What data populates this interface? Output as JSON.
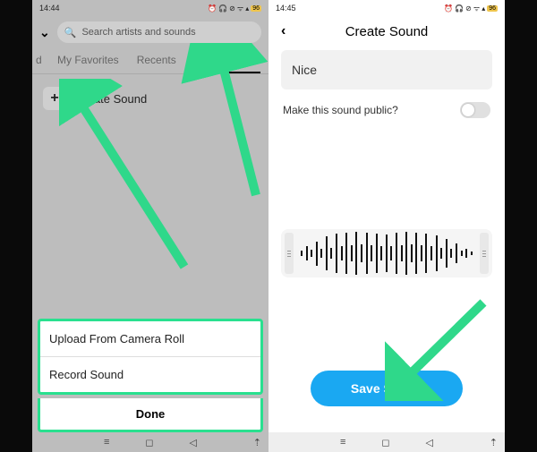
{
  "left": {
    "status": {
      "time": "14:44",
      "battery": "96"
    },
    "search_placeholder": "Search artists and sounds",
    "tabs": {
      "cut": "d",
      "fav": "My Favorites",
      "recents": "Recents",
      "mysounds": "My Sounds"
    },
    "create_sound_label": "Create Sound",
    "sheet": {
      "upload": "Upload From Camera Roll",
      "record": "Record Sound",
      "done": "Done"
    }
  },
  "right": {
    "status": {
      "time": "14:45",
      "battery": "96"
    },
    "title": "Create Sound",
    "sound_name": "Nice",
    "public_label": "Make this sound public?",
    "save_label": "Save Sound"
  }
}
